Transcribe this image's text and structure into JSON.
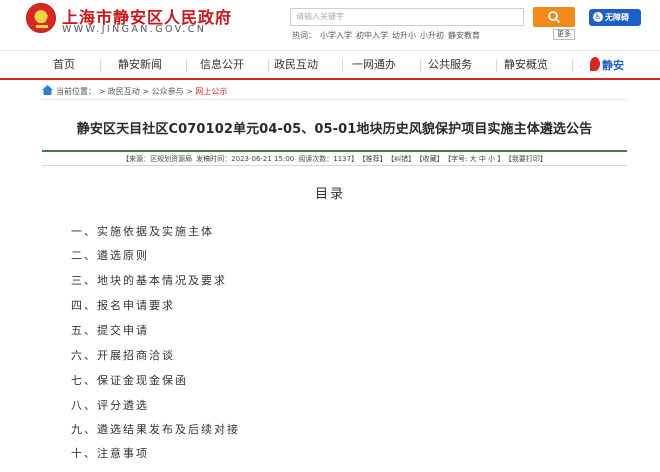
{
  "header": {
    "site_title": "上海市静安区人民政府",
    "site_url": "WWW.JINGAN.GOV.CN",
    "search": {
      "placeholder": "请输入关键字"
    },
    "accessibility_label": "无障碍",
    "hotwords": {
      "label": "热词：",
      "items": [
        "小学入学",
        "初中入学",
        "幼升小",
        "小升初",
        "静安教育"
      ]
    },
    "more_label": "更多"
  },
  "nav": {
    "items": [
      "首页",
      "静安新闻",
      "信息公开",
      "政民互动",
      "一网通办",
      "公共服务",
      "静安概览"
    ],
    "logo_text": "静安"
  },
  "breadcrumb": {
    "prefix": "当前位置：",
    "items": [
      "政民互动",
      "公众参与"
    ],
    "current": "网上公示",
    "separator": " > "
  },
  "article": {
    "title": "静安区天目社区C070102单元04-05、05-01地块历史风貌保护项目实施主体遴选公告",
    "meta": {
      "source": "【来源：区规划资源局",
      "date": "发稿时间：2023-06-21 15:00",
      "views": "阅读次数：1137】",
      "recommend": "【推荐】",
      "report_error": "【纠错】",
      "favorite": "【收藏】",
      "font_size": "【字号: 大 中 小 】",
      "print": "【我要打印】"
    }
  },
  "toc": {
    "heading": "目录",
    "items": [
      "一、实施依据及实施主体",
      "二、遴选原则",
      "三、地块的基本情况及要求",
      "四、报名申请要求",
      "五、提交申请",
      "六、开展招商洽谈",
      "七、保证金现金保函",
      "八、评分遴选",
      "九、遴选结果发布及后续对接",
      "十、注意事项"
    ]
  },
  "colors": {
    "brand_red": "#c8161d",
    "search_orange": "#f08a1b",
    "accessibility_blue": "#1e5fc4",
    "meta_green": "#3e7e45"
  }
}
